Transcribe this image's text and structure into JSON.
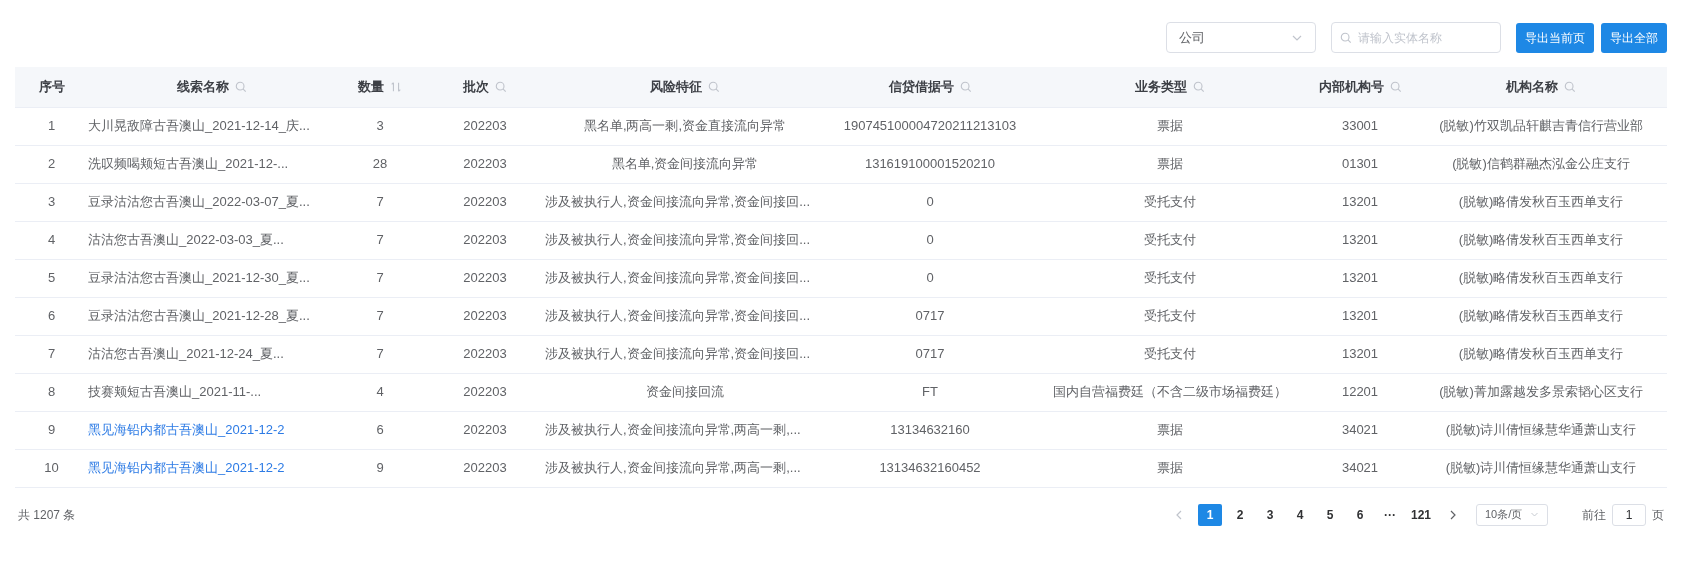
{
  "toolbar": {
    "entity_select": {
      "value": "公司"
    },
    "search": {
      "placeholder": "请输入实体名称"
    },
    "buttons": [
      "导出当前页",
      "导出全部"
    ]
  },
  "table": {
    "columns": [
      {
        "label": "序号",
        "kind": "plain"
      },
      {
        "label": "线索名称",
        "kind": "searchable"
      },
      {
        "label": "数量",
        "kind": "sortable"
      },
      {
        "label": "批次",
        "kind": "searchable"
      },
      {
        "label": "风险特征",
        "kind": "searchable"
      },
      {
        "label": "信贷借据号",
        "kind": "searchable"
      },
      {
        "label": "业务类型",
        "kind": "searchable"
      },
      {
        "label": "内部机构号",
        "kind": "searchable"
      },
      {
        "label": "机构名称",
        "kind": "searchable"
      }
    ],
    "rows": [
      {
        "kind": "text",
        "index": "1",
        "name": "大川晃敌障古吾澳山_2021-12-14_庆...",
        "quantity": "3",
        "batch": "202203",
        "risk": "黑名单,两高一剩,资金直接流向异常",
        "loan_no": "190745100004720211213103",
        "business_type": "票据",
        "org_code": "33001",
        "org_name": "(脱敏)竹双凯品轩麒吉青信行营业部"
      },
      {
        "kind": "text",
        "index": "2",
        "name": "洗叹频喝颊短古吾澳山_2021-12-...",
        "quantity": "28",
        "batch": "202203",
        "risk": "黑名单,资金间接流向异常",
        "loan_no": "131619100001520210",
        "business_type": "票据",
        "org_code": "01301",
        "org_name": "(脱敏)信鹤群融杰泓金公庄支行"
      },
      {
        "kind": "text",
        "index": "3",
        "name": "豆录沽沽您古吾澳山_2022-03-07_夏...",
        "quantity": "7",
        "batch": "202203",
        "risk": "涉及被执行人,资金间接流向异常,资金间接回...",
        "loan_no": "0",
        "business_type": "受托支付",
        "org_code": "13201",
        "org_name": "(脱敏)略倩发秋百玉西单支行"
      },
      {
        "kind": "text",
        "index": "4",
        "name": "沽沽您古吾澳山_2022-03-03_夏...",
        "quantity": "7",
        "batch": "202203",
        "risk": "涉及被执行人,资金间接流向异常,资金间接回...",
        "loan_no": "0",
        "business_type": "受托支付",
        "org_code": "13201",
        "org_name": "(脱敏)略倩发秋百玉西单支行"
      },
      {
        "kind": "text",
        "index": "5",
        "name": "豆录沽沽您古吾澳山_2021-12-30_夏...",
        "quantity": "7",
        "batch": "202203",
        "risk": "涉及被执行人,资金间接流向异常,资金间接回...",
        "loan_no": "0",
        "business_type": "受托支付",
        "org_code": "13201",
        "org_name": "(脱敏)略倩发秋百玉西单支行"
      },
      {
        "kind": "text",
        "index": "6",
        "name": "豆录沽沽您古吾澳山_2021-12-28_夏...",
        "quantity": "7",
        "batch": "202203",
        "risk": "涉及被执行人,资金间接流向异常,资金间接回...",
        "loan_no": "0717",
        "business_type": "受托支付",
        "org_code": "13201",
        "org_name": "(脱敏)略倩发秋百玉西单支行"
      },
      {
        "kind": "text",
        "index": "7",
        "name": "沽沽您古吾澳山_2021-12-24_夏...",
        "quantity": "7",
        "batch": "202203",
        "risk": "涉及被执行人,资金间接流向异常,资金间接回...",
        "loan_no": "0717",
        "business_type": "受托支付",
        "org_code": "13201",
        "org_name": "(脱敏)略倩发秋百玉西单支行"
      },
      {
        "kind": "text",
        "index": "8",
        "name": "技赛颊短古吾澳山_2021-11-...",
        "quantity": "4",
        "batch": "202203",
        "risk": "资金间接回流",
        "loan_no": "FT",
        "business_type": "国内自营福费廷（不含二级市场福费廷）",
        "org_code": "12201",
        "org_name": "(脱敏)菁加露越发多景索韬心区支行"
      },
      {
        "kind": "link",
        "index": "9",
        "name": "黑见海铅内都古吾澳山_2021-12-2",
        "quantity": "6",
        "batch": "202203",
        "risk": "涉及被执行人,资金间接流向异常,两高一剩,...",
        "loan_no": "13134632160",
        "business_type": "票据",
        "org_code": "34021",
        "org_name": "(脱敏)诗川倩恒缘慧华通萧山支行"
      },
      {
        "kind": "link",
        "index": "10",
        "name": "黑见海铅内都古吾澳山_2021-12-2",
        "quantity": "9",
        "batch": "202203",
        "risk": "涉及被执行人,资金间接流向异常,两高一剩,...",
        "loan_no": "13134632160452",
        "business_type": "票据",
        "org_code": "34021",
        "org_name": "(脱敏)诗川倩恒缘慧华通萧山支行"
      }
    ]
  },
  "pagination": {
    "total": "共 1207 条",
    "pages": [
      {
        "label": "1",
        "selected": true
      },
      {
        "label": "2",
        "selected": false
      },
      {
        "label": "3",
        "selected": false
      },
      {
        "label": "4",
        "selected": false
      },
      {
        "label": "5",
        "selected": false
      },
      {
        "label": "6",
        "selected": false
      },
      {
        "label": "···",
        "selected": false
      },
      {
        "label": "121",
        "selected": false
      }
    ],
    "page_size": "10条/页",
    "goto_label": "前往",
    "goto_value": "1",
    "goto_suffix": "页"
  }
}
